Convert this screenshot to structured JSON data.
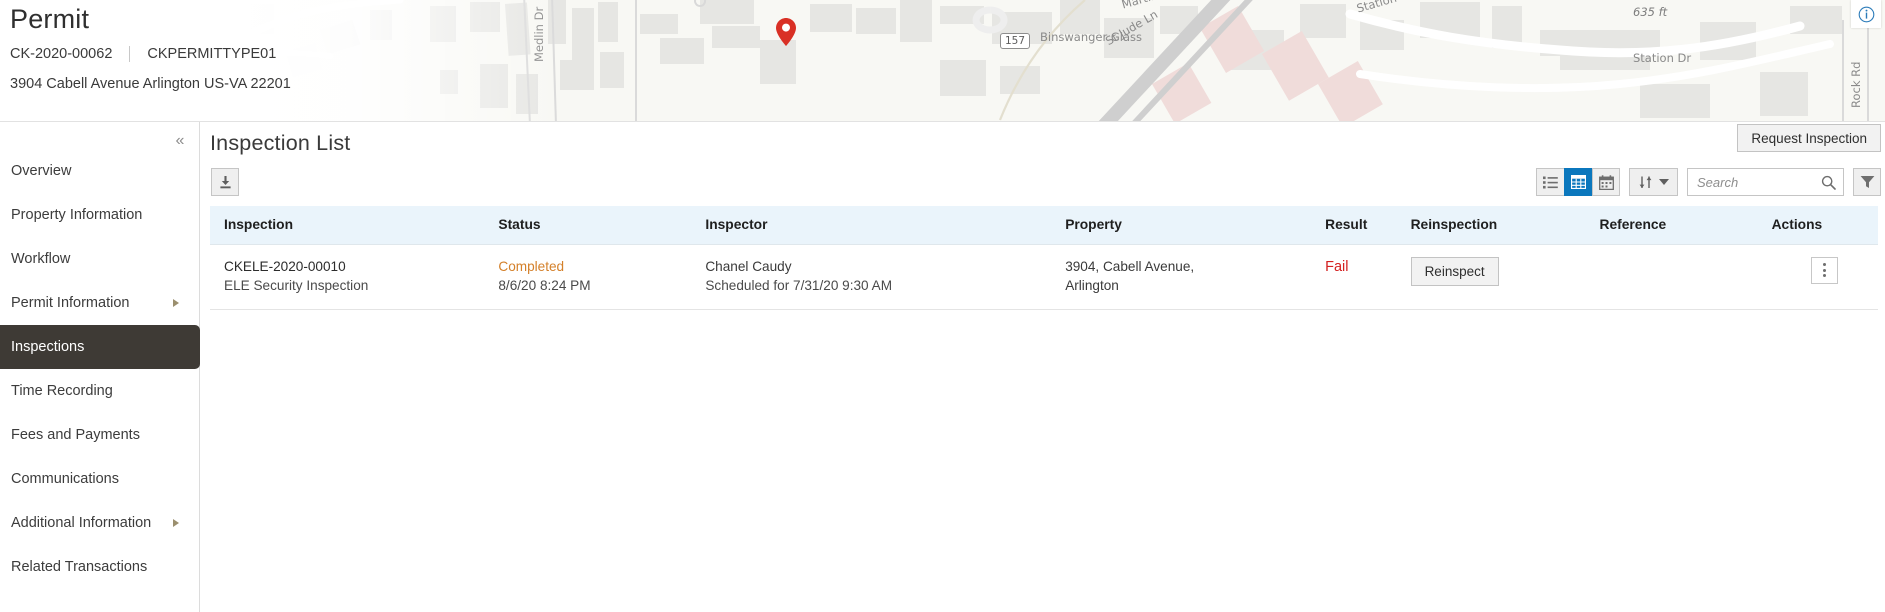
{
  "header": {
    "title": "Permit",
    "permit_number": "CK-2020-00062",
    "permit_type": "CKPERMITTYPE01",
    "address": "3904 Cabell Avenue Arlington US-VA 22201"
  },
  "map": {
    "labels": {
      "medlin_dr": "Medlin Dr",
      "binswanger_glass": "Binswanger Glass",
      "st_jude_ln": "St Jude Ln",
      "martin_dr": "Martin Dr",
      "station_dr": "Station Dr",
      "station_dr_2": "Station Dr",
      "rock_rd": "Rock Rd",
      "scale": "635 ft",
      "route_shield": "157"
    },
    "pin_color": "#d93025",
    "info_icon": "info-circle-icon"
  },
  "sidebar": {
    "collapse_label": "«",
    "items": [
      {
        "label": "Overview",
        "active": false,
        "has_arrow": false
      },
      {
        "label": "Property Information",
        "active": false,
        "has_arrow": false
      },
      {
        "label": "Workflow",
        "active": false,
        "has_arrow": false
      },
      {
        "label": "Permit Information",
        "active": false,
        "has_arrow": true
      },
      {
        "label": "Inspections",
        "active": true,
        "has_arrow": false
      },
      {
        "label": "Time Recording",
        "active": false,
        "has_arrow": false
      },
      {
        "label": "Fees and Payments",
        "active": false,
        "has_arrow": false
      },
      {
        "label": "Communications",
        "active": false,
        "has_arrow": false
      },
      {
        "label": "Additional Information",
        "active": false,
        "has_arrow": true
      },
      {
        "label": "Related Transactions",
        "active": false,
        "has_arrow": false
      }
    ],
    "active_bg": "#3e3a35"
  },
  "main": {
    "page_title": "Inspection List",
    "request_inspection_label": "Request Inspection"
  },
  "toolbar": {
    "download_icon": "download-icon",
    "view_list_icon": "list-view-icon",
    "view_grid_icon": "grid-view-icon",
    "view_calendar_icon": "calendar-view-icon",
    "active_view": "grid",
    "active_view_color": "#0b77bd",
    "sort_icon": "sort-arrows-icon",
    "search_placeholder": "Search",
    "search_value": "",
    "search_icon": "search-icon",
    "filter_icon": "filter-funnel-icon"
  },
  "table": {
    "columns": [
      "Inspection",
      "Status",
      "Inspector",
      "Property",
      "Result",
      "Reinspection",
      "Reference",
      "Actions"
    ],
    "header_bg": "#eaf4fb",
    "rows": [
      {
        "inspection_id": "CKELE-2020-00010",
        "inspection_type": "ELE Security Inspection",
        "status": "Completed",
        "status_color": "#d4802a",
        "status_date": "8/6/20 8:24 PM",
        "inspector_name": "Chanel Caudy",
        "inspector_schedule": "Scheduled for 7/31/20 9:30 AM",
        "property_line1": "3904, Cabell Avenue,",
        "property_line2": "Arlington",
        "result": "Fail",
        "result_color": "#d42020",
        "reinspection_label": "Reinspect",
        "reference": "",
        "actions_icon": "kebab-menu-icon"
      }
    ]
  }
}
